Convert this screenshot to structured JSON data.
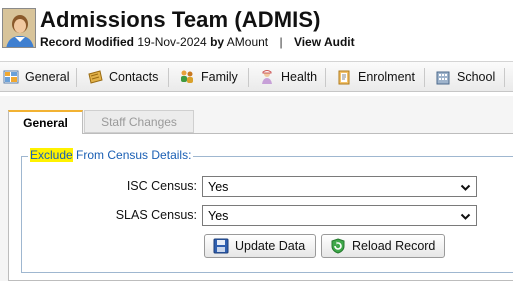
{
  "header": {
    "title": "Admissions Team (ADMIS)",
    "modified_label": "Record Modified",
    "modified_date": "19-Nov-2024",
    "by_label": "by",
    "modified_by": "AMount",
    "separator": "|",
    "view_audit": "View Audit"
  },
  "nav": {
    "items": [
      {
        "label": "General",
        "icon": "grid-icon"
      },
      {
        "label": "Contacts",
        "icon": "address-book-icon"
      },
      {
        "label": "Family",
        "icon": "family-icon"
      },
      {
        "label": "Health",
        "icon": "nurse-icon"
      },
      {
        "label": "Enrolment",
        "icon": "clipboard-icon"
      },
      {
        "label": "School",
        "icon": "building-icon"
      }
    ]
  },
  "tabs": [
    {
      "label": "General",
      "active": true
    },
    {
      "label": "Staff Changes",
      "active": false
    }
  ],
  "census": {
    "legend_highlight": "Exclude",
    "legend_rest": " From Census Details:",
    "isc_label": "ISC Census:",
    "isc_value": "Yes",
    "slas_label": "SLAS Census:",
    "slas_value": "Yes"
  },
  "buttons": {
    "update": "Update Data",
    "reload": "Reload Record"
  },
  "colors": {
    "accent_tab": "#f2b232",
    "legend_text": "#1a5fb4",
    "highlight": "#fff200"
  }
}
